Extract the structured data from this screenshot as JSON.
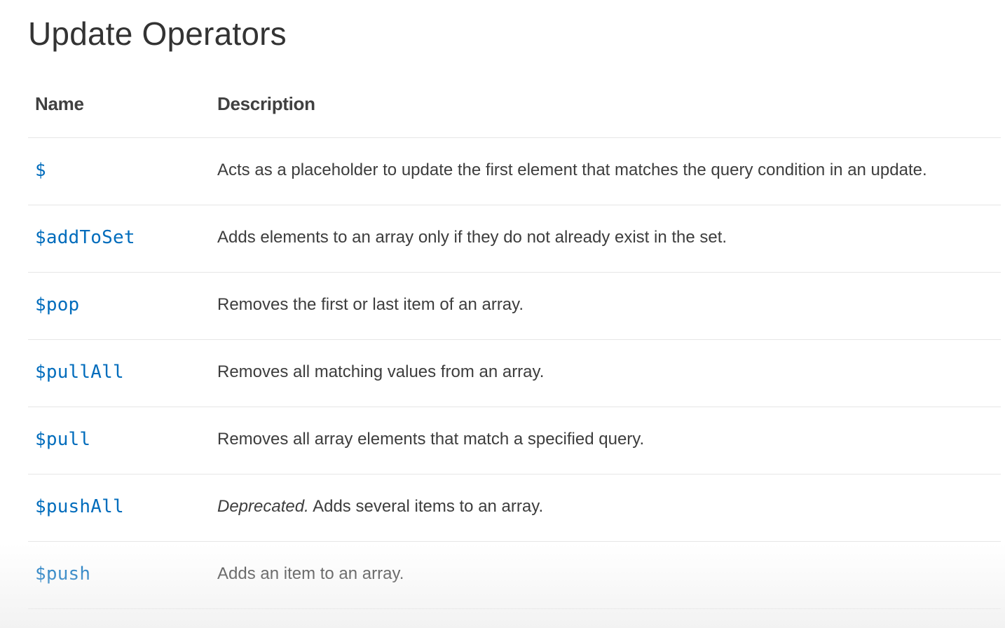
{
  "page": {
    "title": "Update Operators"
  },
  "table": {
    "headers": {
      "name": "Name",
      "description": "Description"
    },
    "rows": [
      {
        "name": "$",
        "prefix": "",
        "description": "Acts as a placeholder to update the first element that matches the query condition in an update."
      },
      {
        "name": "$addToSet",
        "prefix": "",
        "description": "Adds elements to an array only if they do not already exist in the set."
      },
      {
        "name": "$pop",
        "prefix": "",
        "description": "Removes the first or last item of an array."
      },
      {
        "name": "$pullAll",
        "prefix": "",
        "description": "Removes all matching values from an array."
      },
      {
        "name": "$pull",
        "prefix": "",
        "description": "Removes all array elements that match a specified query."
      },
      {
        "name": "$pushAll",
        "prefix": "Deprecated.",
        "description": " Adds several items to an array."
      },
      {
        "name": "$push",
        "prefix": "",
        "description": "Adds an item to an array."
      }
    ]
  },
  "colors": {
    "link": "#006cbc",
    "text": "#3d3d3d",
    "divider": "#e6e6e6"
  }
}
